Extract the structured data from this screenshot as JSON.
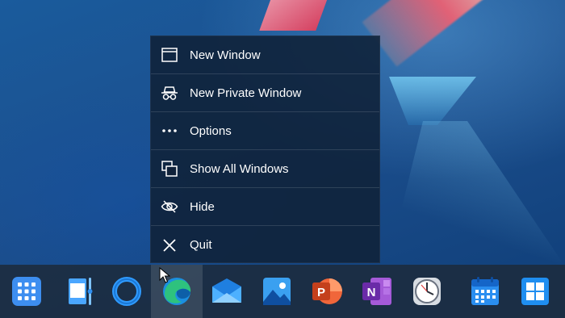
{
  "menu": {
    "items": [
      {
        "label": "New Window",
        "icon": "window-icon"
      },
      {
        "label": "New Private Window",
        "icon": "incognito-icon"
      },
      {
        "label": "Options",
        "icon": "ellipsis-icon"
      },
      {
        "label": "Show All Windows",
        "icon": "stacked-windows-icon"
      },
      {
        "label": "Hide",
        "icon": "eye-slash-icon"
      },
      {
        "label": "Quit",
        "icon": "close-icon"
      }
    ]
  },
  "taskbar": {
    "apps": [
      {
        "name": "start",
        "icon": "app-grid-icon"
      },
      {
        "name": "widgets",
        "icon": "widgets-icon"
      },
      {
        "name": "cortana",
        "icon": "cortana-ring-icon"
      },
      {
        "name": "edge",
        "icon": "edge-icon",
        "active": true
      },
      {
        "name": "mail",
        "icon": "mail-icon"
      },
      {
        "name": "photos",
        "icon": "photos-icon"
      },
      {
        "name": "powerpoint",
        "icon": "powerpoint-icon",
        "letter": "P"
      },
      {
        "name": "onenote",
        "icon": "onenote-icon",
        "letter": "N"
      },
      {
        "name": "clock",
        "icon": "clock-icon"
      },
      {
        "name": "calendar",
        "icon": "calendar-icon"
      },
      {
        "name": "windows",
        "icon": "windows-logo-icon"
      }
    ]
  },
  "colors": {
    "menu_bg": "#10223a",
    "accent_blue": "#1a8cff",
    "taskbar_bg": "#1c2c40"
  }
}
